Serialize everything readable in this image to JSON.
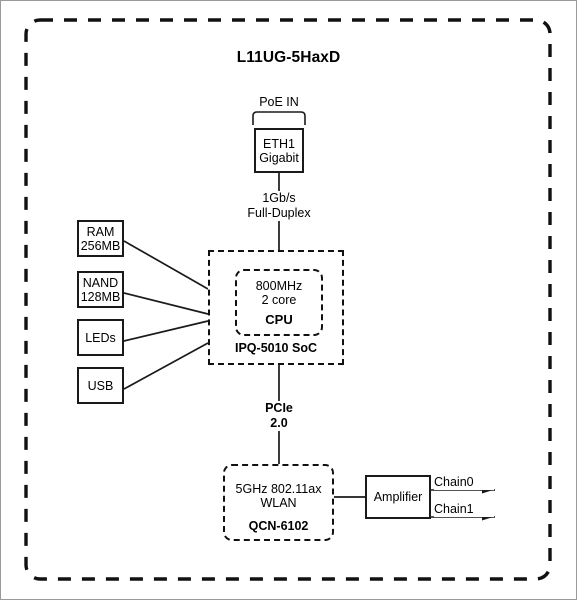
{
  "diagram": {
    "title": "L11UG-5HaxD",
    "outer_border_style": "dashed-rounded",
    "colors": {
      "background": "#ffffff",
      "stroke": "#1a1a1a",
      "text": "#000000"
    },
    "poe": {
      "label": "PoE IN"
    },
    "eth": {
      "line1": "ETH1",
      "line2": "Gigabit"
    },
    "eth_link": {
      "line1": "1Gb/s",
      "line2": "Full-Duplex"
    },
    "peripherals": [
      {
        "name": "ram",
        "line1": "RAM",
        "line2": "256MB"
      },
      {
        "name": "nand",
        "line1": "NAND",
        "line2": "128MB"
      },
      {
        "name": "leds",
        "line1": "LEDs",
        "line2": ""
      },
      {
        "name": "usb",
        "line1": "USB",
        "line2": ""
      }
    ],
    "soc": {
      "name": "IPQ-5010 SoC",
      "cpu": {
        "line1": "800MHz",
        "line2": "2 core",
        "name": "CPU"
      }
    },
    "pcie": {
      "line1": "PCIe",
      "line2": "2.0"
    },
    "wlan": {
      "line1": "5GHz 802.11ax",
      "line2": "WLAN",
      "name": "QCN-6102"
    },
    "amplifier": {
      "label": "Amplifier"
    },
    "chains": [
      {
        "label": "Chain0"
      },
      {
        "label": "Chain1"
      }
    ]
  }
}
